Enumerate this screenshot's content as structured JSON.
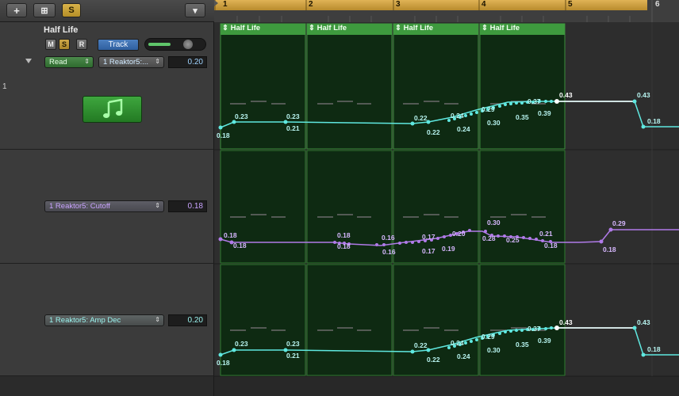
{
  "toolbar": {
    "add_glyph": "+",
    "folder_glyph": "⊞",
    "solo_label": "S",
    "dropdown_glyph": "▾"
  },
  "track": {
    "number": "1",
    "name": "Half Life",
    "mute": "M",
    "solo": "S",
    "record": "R",
    "track_button": "Track",
    "mode": "Read",
    "mode_arrow": "⇕",
    "param": "1 Reaktor5:...",
    "param_value": "0.20",
    "icon": "music-note-icon"
  },
  "lanes": [
    {
      "param": "1 Reaktor5: Cutoff",
      "value": "0.18"
    },
    {
      "param": "1 Reaktor5: Amp Dec",
      "value": "0.20"
    }
  ],
  "ruler": {
    "bars": [
      "1",
      "2",
      "3",
      "4",
      "5",
      "6"
    ]
  },
  "regions": [
    {
      "name": "Half Life"
    },
    {
      "name": "Half Life"
    },
    {
      "name": "Half Life"
    },
    {
      "name": "Half Life"
    }
  ],
  "region_arrow": "⇕",
  "automation": {
    "lane1": [
      "0.18",
      "0.23",
      "0.23",
      "0.21",
      "0.22",
      "0.22",
      "0.24",
      "0.24",
      "0.29",
      "0.30",
      "0.37",
      "0.35",
      "0.39",
      "0.43",
      "0.43",
      "0.18"
    ],
    "lane2": [
      "0.18",
      "0.18",
      "0.18",
      "0.18",
      "0.16",
      "0.16",
      "0.17",
      "0.17",
      "0.20",
      "0.19",
      "0.30",
      "0.28",
      "0.25",
      "0.21",
      "0.18",
      "0.29",
      "0.18"
    ],
    "lane3": [
      "0.18",
      "0.23",
      "0.23",
      "0.21",
      "0.22",
      "0.22",
      "0.24",
      "0.24",
      "0.29",
      "0.30",
      "0.37",
      "0.35",
      "0.39",
      "0.43",
      "0.43",
      "0.18"
    ]
  },
  "colors": {
    "cyan": "#5fe8e0",
    "purple": "#b07ae8",
    "region_green": "#3e9a3e",
    "ruler_gold": "#d8a845"
  }
}
